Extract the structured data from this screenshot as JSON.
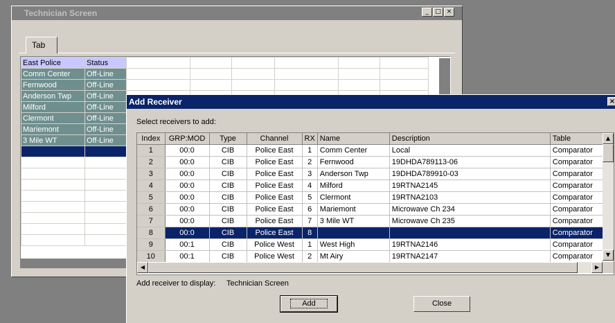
{
  "tech_window": {
    "title": "Technician Screen",
    "controls": {
      "minimize": "_",
      "maximize": "□",
      "close": "×"
    },
    "tab_label": "Tab",
    "grid_headers": [
      "East Police",
      "Status"
    ],
    "grid_rows": [
      {
        "name": "Comm Center",
        "status": "Off-Line"
      },
      {
        "name": "Fernwood",
        "status": "Off-Line"
      },
      {
        "name": "Anderson Twp",
        "status": "Off-Line"
      },
      {
        "name": "Milford",
        "status": "Off-Line"
      },
      {
        "name": "Clermont",
        "status": "Off-Line"
      },
      {
        "name": "Mariemont",
        "status": "Off-Line"
      },
      {
        "name": "3 Mile WT",
        "status": "Off-Line"
      }
    ]
  },
  "dialog": {
    "title": "Add Receiver",
    "close_glyph": "×",
    "prompt": "Select receivers to add:",
    "columns": [
      "Index",
      "GRP:MOD",
      "Type",
      "Channel",
      "RX",
      "Name",
      "Description",
      "Table"
    ],
    "rows": [
      {
        "index": "1",
        "grpmod": "00:0",
        "type": "CIB",
        "channel": "Police East",
        "rx": "1",
        "name": "Comm Center",
        "description": "Local",
        "table": "Comparator"
      },
      {
        "index": "2",
        "grpmod": "00:0",
        "type": "CIB",
        "channel": "Police East",
        "rx": "2",
        "name": "Fernwood",
        "description": "19DHDA789113-06",
        "table": "Comparator"
      },
      {
        "index": "3",
        "grpmod": "00:0",
        "type": "CIB",
        "channel": "Police East",
        "rx": "3",
        "name": "Anderson Twp",
        "description": "19DHDA789910-03",
        "table": "Comparator"
      },
      {
        "index": "4",
        "grpmod": "00:0",
        "type": "CIB",
        "channel": "Police East",
        "rx": "4",
        "name": "Milford",
        "description": "19RTNA2145",
        "table": "Comparator"
      },
      {
        "index": "5",
        "grpmod": "00:0",
        "type": "CIB",
        "channel": "Police East",
        "rx": "5",
        "name": "Clermont",
        "description": "19RTNA2103",
        "table": "Comparator"
      },
      {
        "index": "6",
        "grpmod": "00:0",
        "type": "CIB",
        "channel": "Police East",
        "rx": "6",
        "name": "Mariemont",
        "description": "Microwave Ch 234",
        "table": "Comparator"
      },
      {
        "index": "7",
        "grpmod": "00:0",
        "type": "CIB",
        "channel": "Police East",
        "rx": "7",
        "name": "3 Mile WT",
        "description": "Microwave Ch 235",
        "table": "Comparator"
      },
      {
        "index": "8",
        "grpmod": "00:0",
        "type": "CIB",
        "channel": "Police East",
        "rx": "8",
        "name": "",
        "description": "",
        "table": "Comparator"
      },
      {
        "index": "9",
        "grpmod": "00:1",
        "type": "CIB",
        "channel": "Police West",
        "rx": "1",
        "name": "West High",
        "description": "19RTNA2146",
        "table": "Comparator"
      },
      {
        "index": "10",
        "grpmod": "00:1",
        "type": "CIB",
        "channel": "Police West",
        "rx": "2",
        "name": "Mt Airy",
        "description": "19RTNA2147",
        "table": "Comparator"
      }
    ],
    "selected_index": "8",
    "target_label": "Add receiver to display:",
    "target_value": "Technician Screen",
    "add_button": "Add",
    "close_button": "Close",
    "scroll_glyphs": {
      "up": "▲",
      "down": "▼",
      "left": "◀",
      "right": "▶"
    }
  }
}
